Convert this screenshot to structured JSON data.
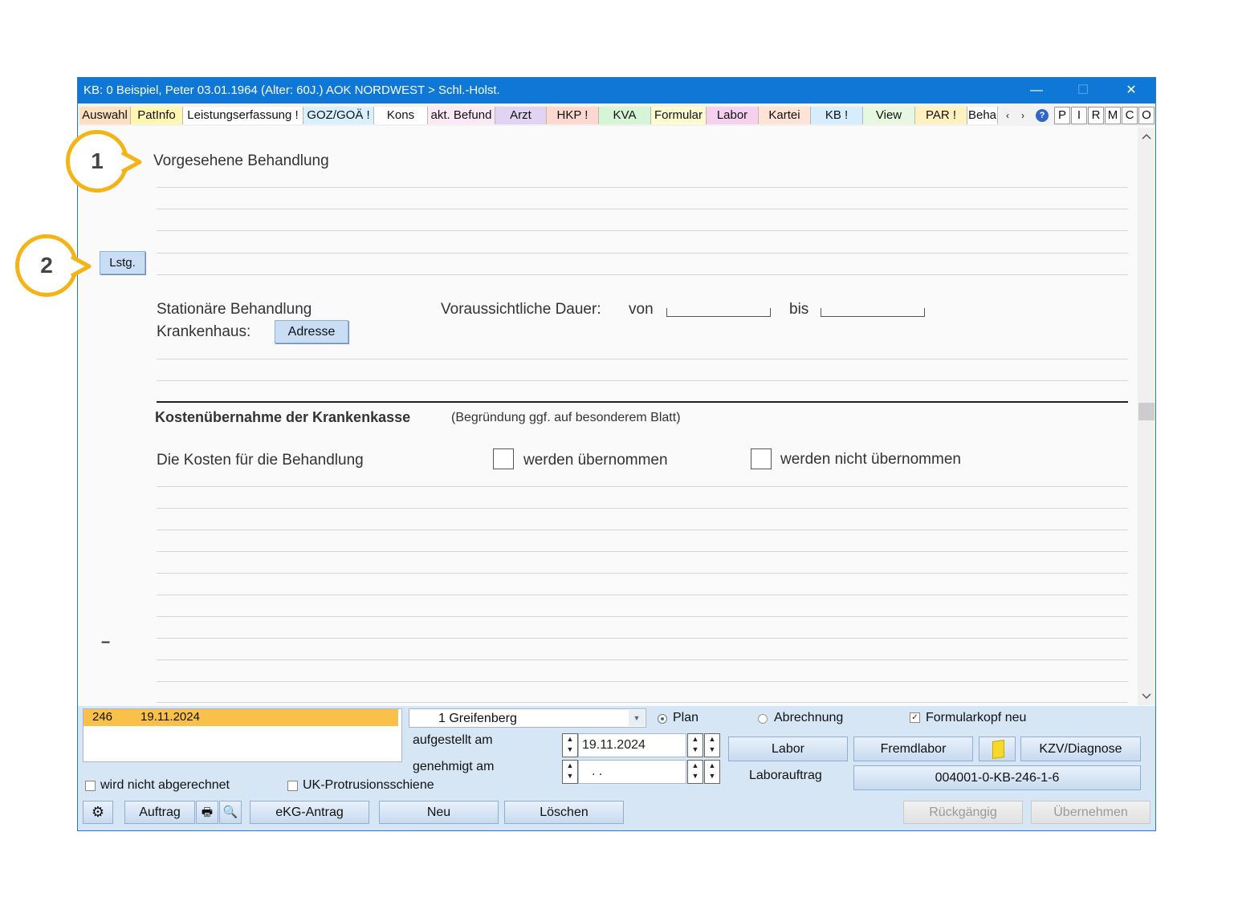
{
  "window": {
    "title": "KB: 0  Beispiel, Peter  03.01.1964 (Alter: 60J.)  AOK NORDWEST > Schl.-Holst.",
    "minimize_glyph": "—",
    "maximize_glyph": "☐",
    "close_glyph": "✕"
  },
  "tabs": [
    {
      "label": "Auswahl",
      "color": "#fde0c0"
    },
    {
      "label": "PatInfo",
      "color": "#fff7b0"
    },
    {
      "label": "Leistungserfassung !",
      "color": "#ffffff"
    },
    {
      "label": "GOZ/GOÄ !",
      "color": "#d9f0ff"
    },
    {
      "label": "Kons",
      "color": "#ffffff"
    },
    {
      "label": "akt. Befund",
      "color": "#fbe9f6"
    },
    {
      "label": "Arzt",
      "color": "#e3d3f2"
    },
    {
      "label": "HKP !",
      "color": "#ffd9d0"
    },
    {
      "label": "KVA",
      "color": "#d6f5d6"
    },
    {
      "label": "Formular",
      "color": "#fffbd0"
    },
    {
      "label": "Labor",
      "color": "#f6d0ef"
    },
    {
      "label": "Kartei",
      "color": "#ffe3d6"
    },
    {
      "label": "KB !",
      "color": "#d6ecff"
    },
    {
      "label": "View",
      "color": "#e7f8e0"
    },
    {
      "label": "PAR !",
      "color": "#fff2c0"
    },
    {
      "label": "Beha",
      "color": "#ffffff"
    }
  ],
  "tab_scroll": {
    "left": "‹",
    "right": "›"
  },
  "side_buttons": [
    "P",
    "I",
    "R",
    "M",
    "C",
    "O"
  ],
  "help_icon_glyph": "?",
  "form": {
    "heading": "Vorgesehene Behandlung",
    "lstg_button": "Lstg.",
    "stationaer_label": "Stationäre Behandlung",
    "krankenhaus_label": "Krankenhaus:",
    "adresse_button": "Adresse",
    "dauer_label": "Voraussichtliche Dauer:",
    "von_label": "von",
    "bis_label": "bis",
    "kosten_heading": "Kostenübernahme der Krankenkasse",
    "kosten_note": "(Begründung ggf. auf besonderem Blatt)",
    "kosten_text": "Die Kosten für die Behandlung",
    "option_yes": "werden übernommen",
    "option_no": "werden nicht übernommen",
    "dash": "–"
  },
  "bottom": {
    "list_entry": {
      "id": "246",
      "date": "19.11.2024"
    },
    "location_select": "1 Greifenberg",
    "plan_label": "Plan",
    "abrechnung_label": "Abrechnung",
    "formularkopf_label": "Formularkopf neu",
    "aufgestellt_label": "aufgestellt am",
    "aufgestellt_value": "19.11.2024",
    "genehmigt_label": "genehmigt am",
    "genehmigt_value": " .   .",
    "labor_button": "Labor",
    "fremdlabor_button": "Fremdlabor",
    "kzv_button": "KZV/Diagnose",
    "laborauftrag_label": "Laborauftrag",
    "laborauftrag_value": "004001-0-KB-246-1-6",
    "wird_nicht_label": "wird nicht abgerechnet",
    "uk_label": "UK-Protrusionsschiene",
    "auftrag_button": "Auftrag",
    "ekg_button": "eKG-Antrag",
    "neu_button": "Neu",
    "loeschen_button": "Löschen",
    "rueckgaengig_button": "Rückgängig",
    "uebernehmen_button": "Übernehmen"
  },
  "callouts": [
    "1",
    "2"
  ],
  "colors": {
    "accent": "#0f78d7",
    "callout": "#f3b418",
    "list_highlight": "#f9c04a"
  }
}
